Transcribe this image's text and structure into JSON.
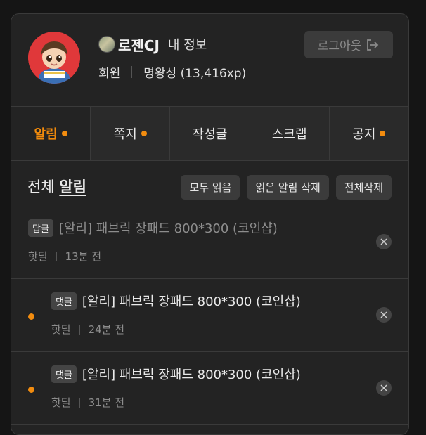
{
  "profile": {
    "nickname": "로젠CJ",
    "my_info_label": "내 정보",
    "role": "회원",
    "level": "명왕성 (13,416xp)",
    "logout_label": "로그아웃"
  },
  "tabs": [
    {
      "label": "알림",
      "active": true,
      "has_dot": true
    },
    {
      "label": "쪽지",
      "active": false,
      "has_dot": true
    },
    {
      "label": "작성글",
      "active": false,
      "has_dot": false
    },
    {
      "label": "스크랩",
      "active": false,
      "has_dot": false
    },
    {
      "label": "공지",
      "active": false,
      "has_dot": true
    }
  ],
  "notifications_header": {
    "title_prefix": "전체",
    "title_strong": "알림",
    "mark_all_read": "모두 읽음",
    "delete_read": "읽은 알림 삭제",
    "delete_all": "전체삭제"
  },
  "notifications": [
    {
      "tag": "답글",
      "title": "[알리] 패브릭 장패드 800*300 (코인샵)",
      "board": "핫딜",
      "time": "13분 전",
      "read": true
    },
    {
      "tag": "댓글",
      "title": "[알리] 패브릭 장패드 800*300 (코인샵)",
      "board": "핫딜",
      "time": "24분 전",
      "read": false
    },
    {
      "tag": "댓글",
      "title": "[알리] 패브릭 장패드 800*300 (코인샵)",
      "board": "핫딜",
      "time": "31분 전",
      "read": false
    }
  ],
  "colors": {
    "accent": "#f28c0f",
    "panel": "#232323",
    "button": "#3b3b3b"
  }
}
